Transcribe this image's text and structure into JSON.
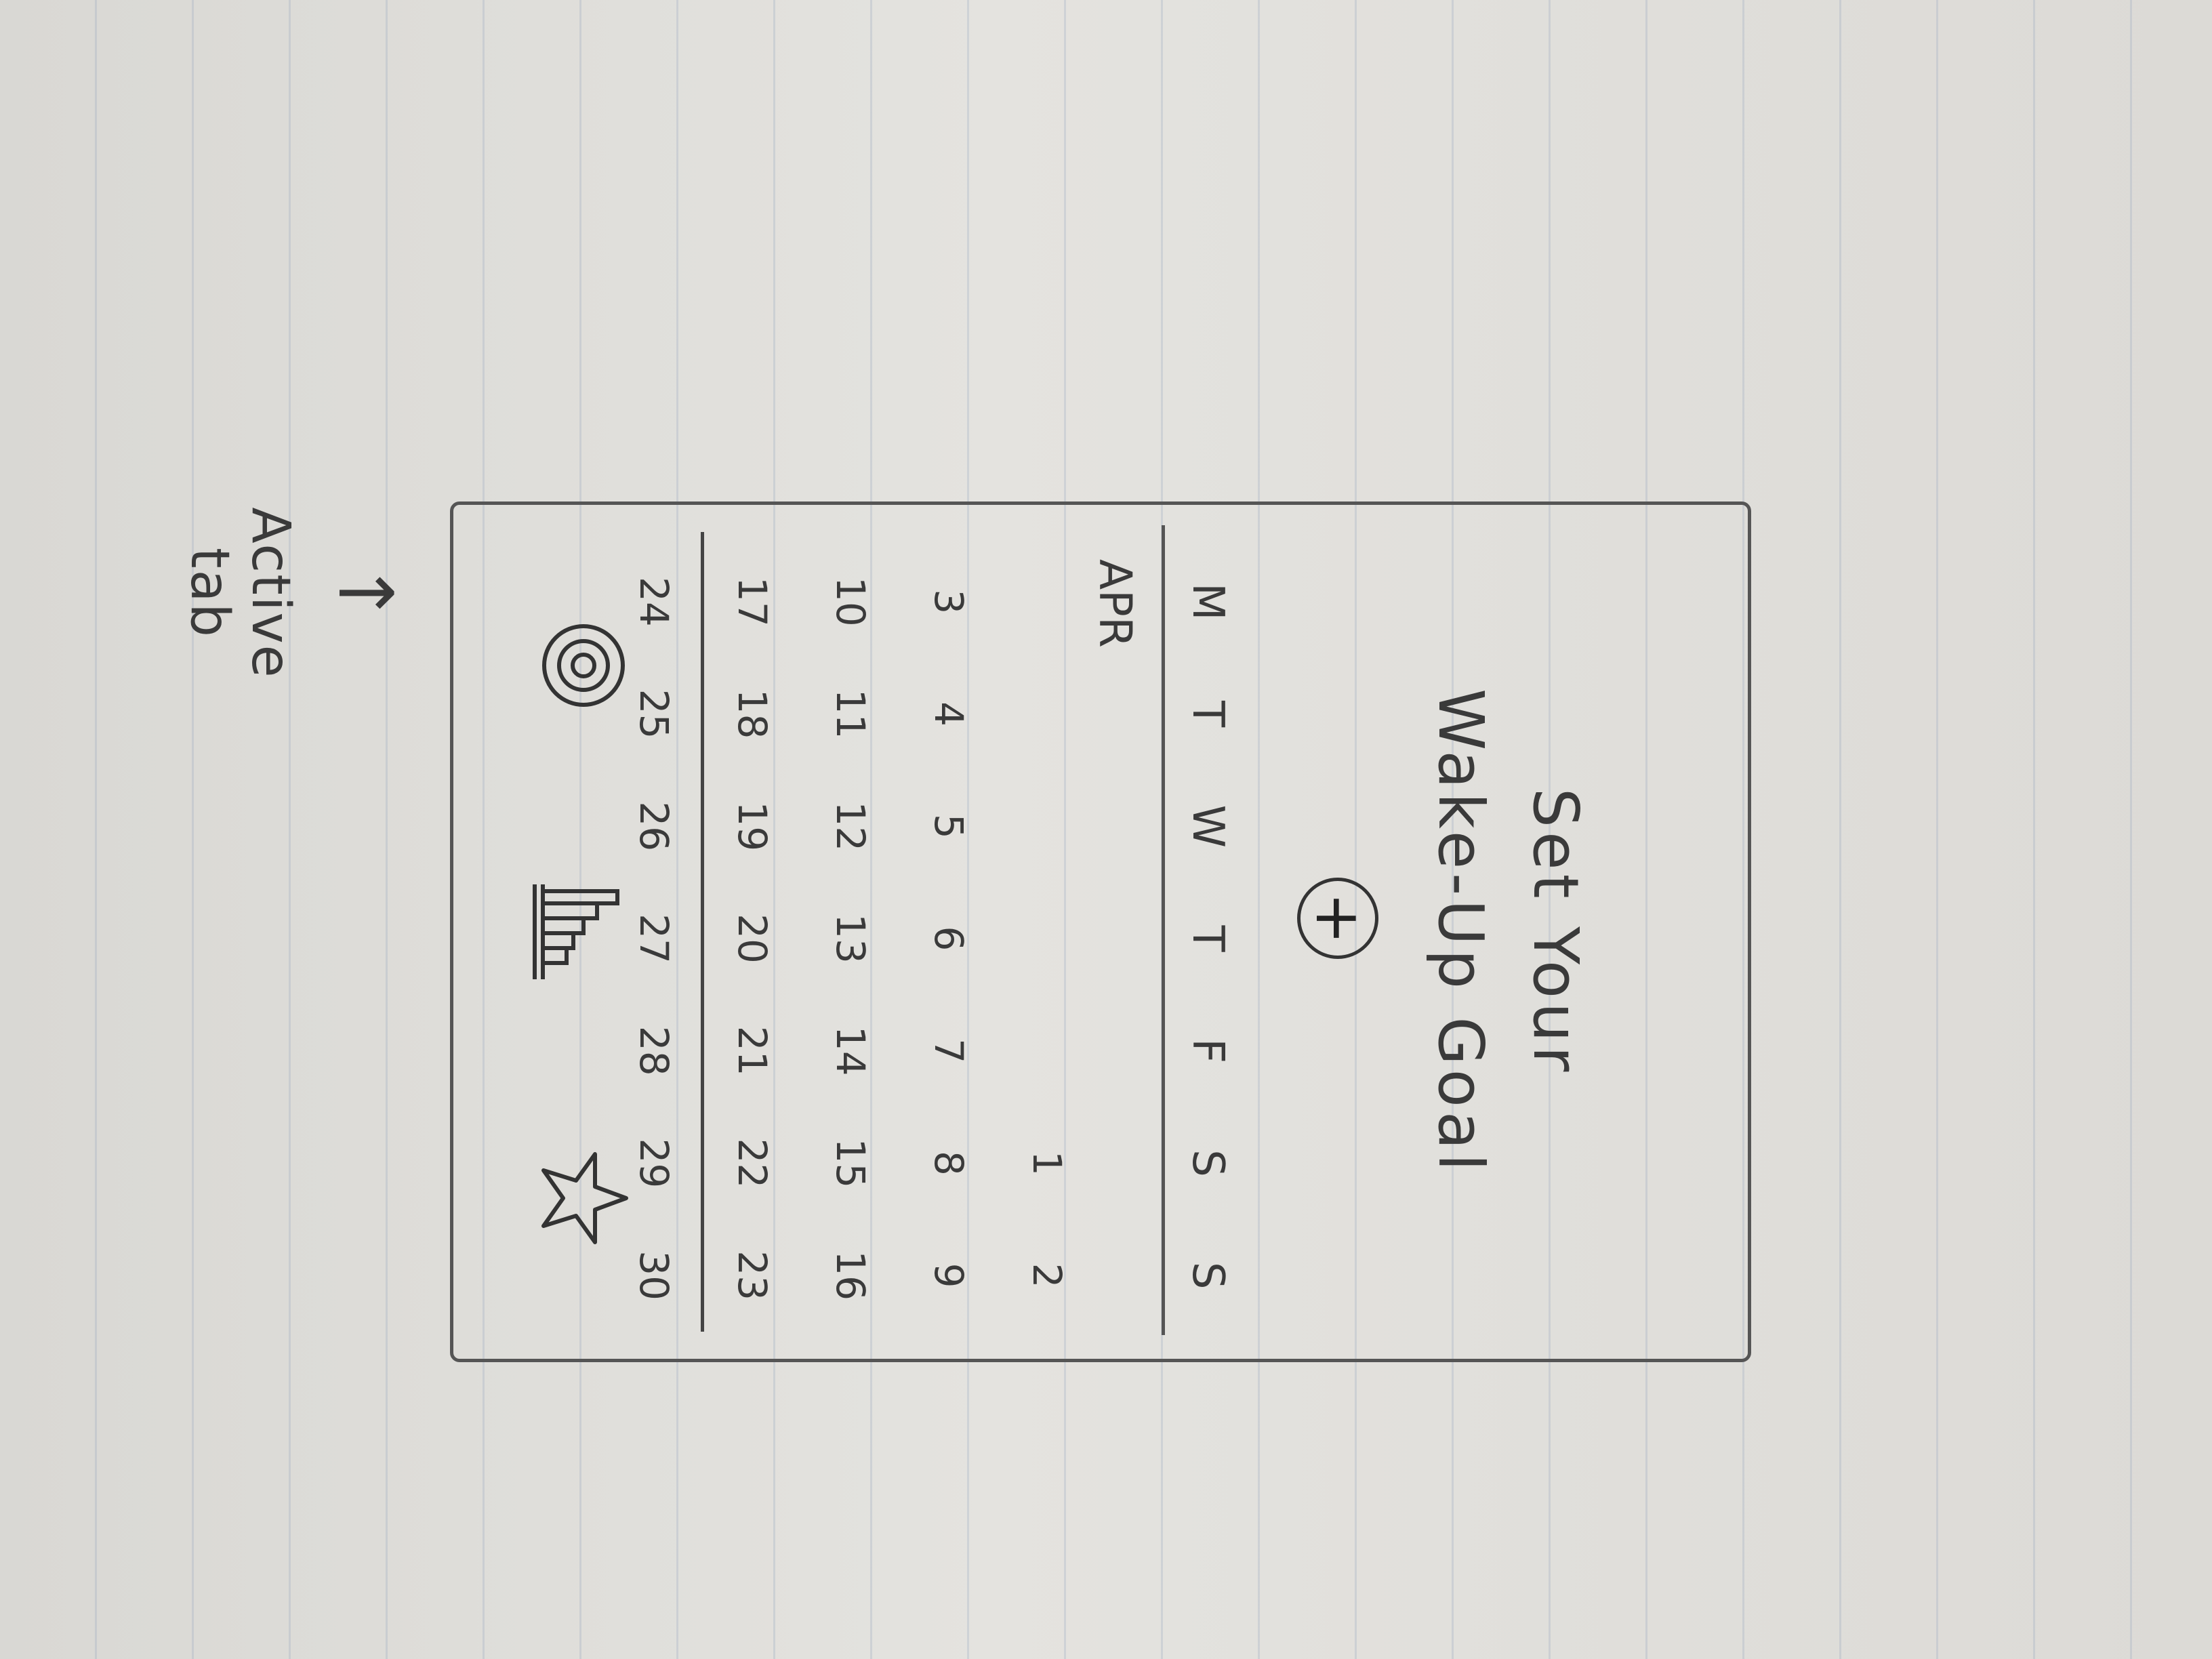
{
  "header": {
    "title_line1": "Set Your",
    "title_line2": "Wake-Up Goal",
    "add_symbol": "+"
  },
  "calendar": {
    "weekdays": [
      "M",
      "T",
      "W",
      "T",
      "F",
      "S",
      "S"
    ],
    "month_label": "APR",
    "weeks": [
      [
        "",
        "",
        "",
        "",
        "",
        "1",
        "2"
      ],
      [
        "3",
        "4",
        "5",
        "6",
        "7",
        "8",
        "9"
      ],
      [
        "10",
        "11",
        "12",
        "13",
        "14",
        "15",
        "16"
      ],
      [
        "17",
        "18",
        "19",
        "20",
        "21",
        "22",
        "23"
      ],
      [
        "24",
        "25",
        "26",
        "27",
        "28",
        "29",
        "30"
      ]
    ]
  },
  "tab_bar": {
    "tabs": [
      {
        "icon": "target-icon",
        "active": true
      },
      {
        "icon": "bar-chart-icon",
        "active": false
      },
      {
        "icon": "star-icon",
        "active": false
      }
    ]
  },
  "annotation": {
    "arrow": "↑",
    "label": "Active tab"
  }
}
